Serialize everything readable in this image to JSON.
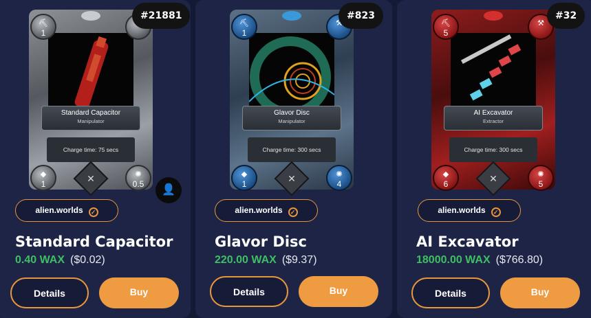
{
  "cards": [
    {
      "badge": "#21881",
      "name": "Standard Capacitor",
      "type": "Manipulator",
      "charge": "Charge time: 75 secs",
      "top_left": "1",
      "bottom_left": "1",
      "bottom_right": "0.5",
      "collection": "alien.worlds",
      "title": "Standard Capacitor",
      "price_wax": "0.40 WAX",
      "price_usd": "($0.02)",
      "details_label": "Details",
      "buy_label": "Buy"
    },
    {
      "badge": "#823",
      "name": "Glavor Disc",
      "type": "Manipulator",
      "charge": "Charge time: 300 secs",
      "top_left": "1",
      "bottom_left": "1",
      "bottom_right": "4",
      "collection": "alien.worlds",
      "title": "Glavor Disc",
      "price_wax": "220.00 WAX",
      "price_usd": "($9.37)",
      "details_label": "Details",
      "buy_label": "Buy"
    },
    {
      "badge": "#32",
      "name": "AI Excavator",
      "type": "Extractor",
      "charge": "Charge time: 300 secs",
      "top_left": "5",
      "bottom_left": "6",
      "bottom_right": "5",
      "collection": "alien.worlds",
      "title": "AI Excavator",
      "price_wax": "18000.00 WAX",
      "price_usd": "($766.80)",
      "details_label": "Details",
      "buy_label": "Buy"
    }
  ],
  "colors": {
    "accent": "#e8963c",
    "wax_green": "#3fbf63",
    "panel": "#1d2446",
    "background": "#141a35"
  },
  "icons": {
    "pickaxe": "pickaxe-icon",
    "planet": "planet-icon",
    "trilium": "trilium-icon",
    "gear": "gear-icon",
    "user": "user-icon",
    "verified": "check-circle-icon"
  }
}
